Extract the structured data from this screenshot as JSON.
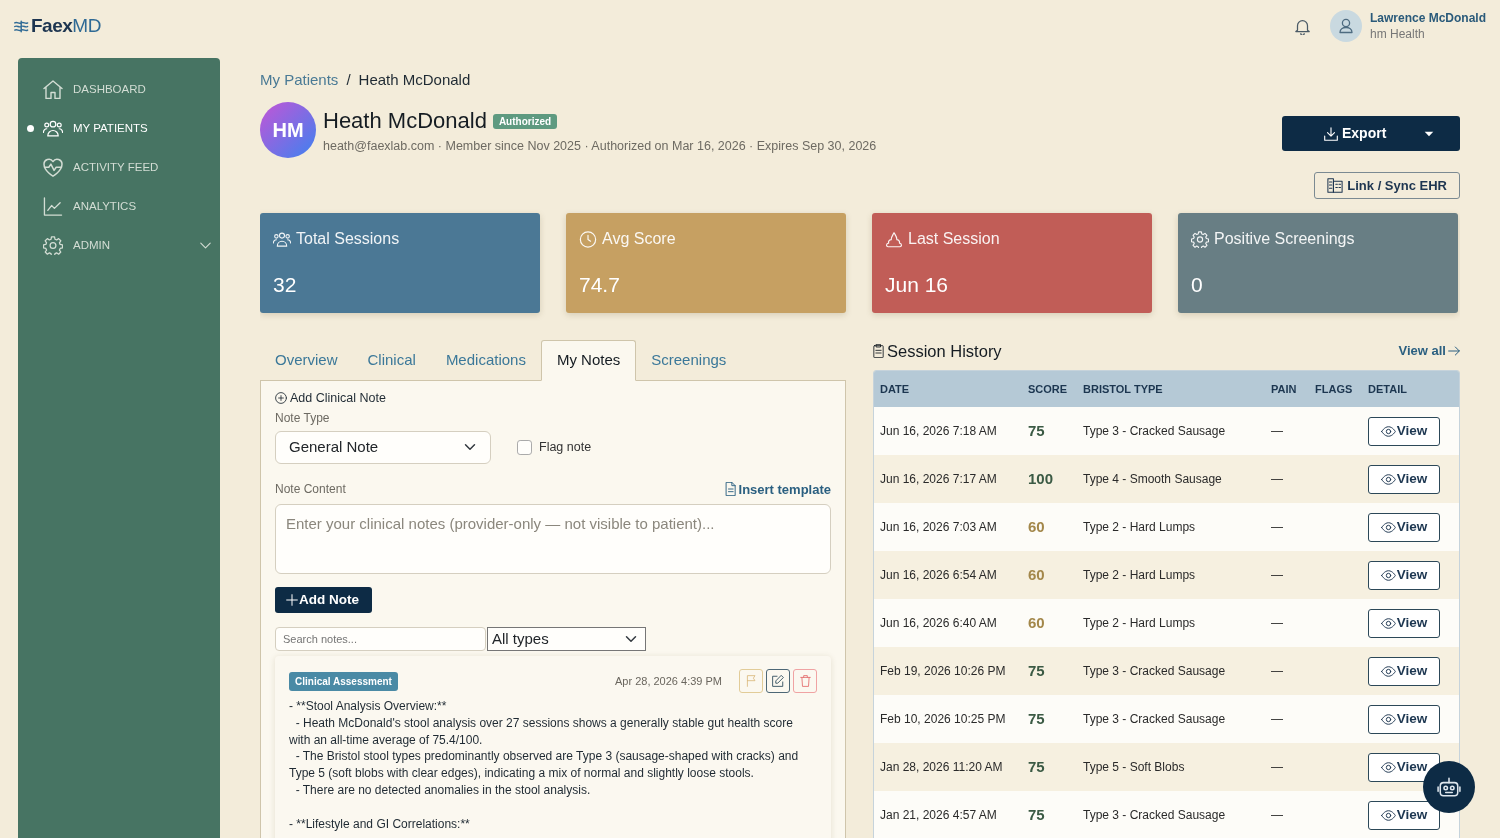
{
  "logo": {
    "text": "**Faex**MD"
  },
  "header": {
    "user": {
      "name": "Lawrence McDonald",
      "org": "hm Health"
    }
  },
  "sidebar": {
    "items": [
      {
        "label": "DASHBOARD",
        "kind": "link",
        "selected": false
      },
      {
        "label": "MY PATIENTS",
        "kind": "link",
        "selected": true
      },
      {
        "label": "ACTIVITY FEED",
        "kind": "link",
        "selected": false
      },
      {
        "label": "ANALYTICS",
        "kind": "link",
        "selected": false
      },
      {
        "label": "ADMIN",
        "kind": "group",
        "selected": false
      }
    ]
  },
  "breadcrumb": {
    "separator": "/",
    "items": [
      {
        "label": "My Patients",
        "kind": "link"
      },
      {
        "label": "Heath McDonald",
        "kind": "current"
      }
    ]
  },
  "patient": {
    "initials": "HM",
    "name": "Heath McDonald",
    "status_badge": "Authorized",
    "details": "heath@faexlab.com · Member since Nov 2025 · Authorized on Mar 16, 2026 · Expires Sep 30, 2026"
  },
  "actions": {
    "export": "Export",
    "link_ehr": "Link / Sync EHR"
  },
  "stats": [
    {
      "label": "Total Sessions",
      "value": "32",
      "color": "#4b7895"
    },
    {
      "label": "Avg Score",
      "value": "74.7",
      "color": "#c6a062"
    },
    {
      "label": "Last Session",
      "value": "Jun 16",
      "color": "#c15d57"
    },
    {
      "label": "Positive Screenings",
      "value": "0",
      "color": "#687e84"
    }
  ],
  "tabs": [
    {
      "label": "Overview",
      "selected": false
    },
    {
      "label": "Clinical",
      "selected": false
    },
    {
      "label": "Medications",
      "selected": false
    },
    {
      "label": "My Notes",
      "selected": true
    },
    {
      "label": "Screenings",
      "selected": false
    }
  ],
  "note_form": {
    "title": "Add Clinical Note",
    "note_type_label": "Note Type",
    "note_type_value": "General Note",
    "flag": {
      "label": "Flag note",
      "checked": false
    },
    "content_label": "Note Content",
    "insert_template": "Insert template",
    "content_placeholder": "Enter your clinical notes (provider-only — not visible to patient)...",
    "submit": "Add Note"
  },
  "notes_filter": {
    "search_placeholder": "Search notes...",
    "type_value": "All types"
  },
  "notes": [
    {
      "tag": "Clinical Assessment",
      "time": "Apr 28, 2026 4:39 PM",
      "body": "- **Stool Analysis Overview:**\n  - Heath McDonald's stool analysis over 27 sessions shows a generally stable gut health score with an all-time average of 75.4/100.\n  - The Bristol stool types predominantly observed are Type 3 (sausage-shaped with cracks) and Type 5 (soft blobs with clear edges), indicating a mix of normal and slightly loose stools.\n  - There are no detected anomalies in the stool analysis.\n\n- **Lifestyle and GI Correlations:**"
    }
  ],
  "session_history": {
    "title": "Session History",
    "view_all": "View all",
    "columns": [
      "DATE",
      "SCORE",
      "BRISTOL TYPE",
      "PAIN",
      "FLAGS",
      "DETAIL"
    ],
    "rows": [
      {
        "date": "Jun 16, 2026 7:18 AM",
        "score": "75",
        "color": "#3b5a44",
        "bristol_type": "Type 3 - Cracked Sausage",
        "pain": "—",
        "detail": "View"
      },
      {
        "date": "Jun 16, 2026 7:17 AM",
        "score": "100",
        "color": "#3b5a44",
        "bristol_type": "Type 4 - Smooth Sausage",
        "pain": "—",
        "detail": "View"
      },
      {
        "date": "Jun 16, 2026 7:03 AM",
        "score": "60",
        "color": "#a3874a",
        "bristol_type": "Type 2 - Hard Lumps",
        "pain": "—",
        "detail": "View"
      },
      {
        "date": "Jun 16, 2026 6:54 AM",
        "score": "60",
        "color": "#a3874a",
        "bristol_type": "Type 2 - Hard Lumps",
        "pain": "—",
        "detail": "View"
      },
      {
        "date": "Jun 16, 2026 6:40 AM",
        "score": "60",
        "color": "#a3874a",
        "bristol_type": "Type 2 - Hard Lumps",
        "pain": "—",
        "detail": "View"
      },
      {
        "date": "Feb 19, 2026 10:26 PM",
        "score": "75",
        "color": "#3b5a44",
        "bristol_type": "Type 3 - Cracked Sausage",
        "pain": "—",
        "detail": "View"
      },
      {
        "date": "Feb 10, 2026 10:25 PM",
        "score": "75",
        "color": "#3b5a44",
        "bristol_type": "Type 3 - Cracked Sausage",
        "pain": "—",
        "detail": "View"
      },
      {
        "date": "Jan 28, 2026 11:20 AM",
        "score": "75",
        "color": "#3b5a44",
        "bristol_type": "Type 5 - Soft Blobs",
        "pain": "—",
        "detail": "View"
      },
      {
        "date": "Jan 21, 2026 4:57 AM",
        "score": "75",
        "color": "#3b5a44",
        "bristol_type": "Type 3 - Cracked Sausage",
        "pain": "—",
        "detail": "View"
      }
    ]
  }
}
